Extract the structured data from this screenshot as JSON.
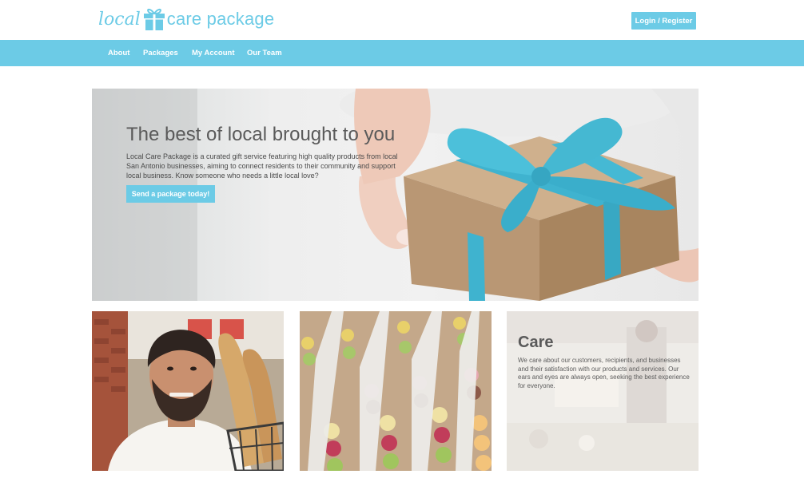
{
  "brand": {
    "logo_local": "local",
    "logo_care": "care package",
    "icon": "gift-icon",
    "accent": "#6ccbe6"
  },
  "header": {
    "login_label": "Login / Register"
  },
  "nav": {
    "items": [
      {
        "label": "About"
      },
      {
        "label": "Packages"
      },
      {
        "label": "My Account"
      },
      {
        "label": "Our Team"
      }
    ]
  },
  "hero": {
    "title": "The best of local brought to you",
    "body": "Local Care Package is a curated gift service featuring high quality products from local San Antonio businesses, aiming to connect residents to their community and support local business. Know someone who needs a little local love?",
    "cta_label": "Send a package today!"
  },
  "cards": {
    "care": {
      "title": "Care",
      "body": "We care about our customers, recipients, and businesses and their satisfaction with our products and services. Our ears and eyes are always open, seeking the best experience for everyone."
    }
  }
}
